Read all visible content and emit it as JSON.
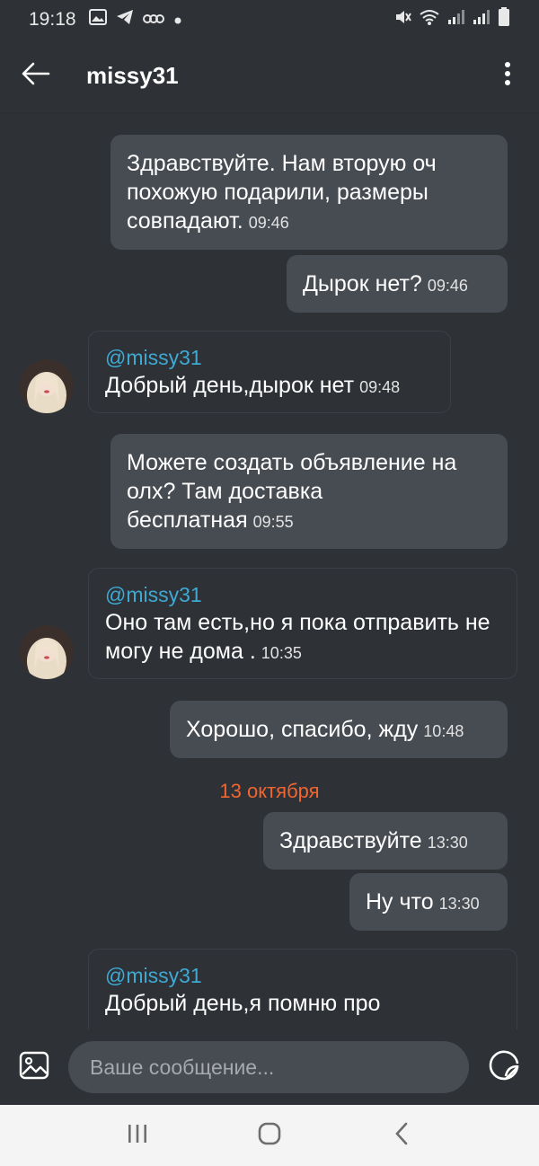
{
  "status_bar": {
    "time": "19:18",
    "icons_left": [
      "gallery-icon",
      "telegram-icon",
      "vpn-icon",
      "dot-icon"
    ],
    "icons_right": [
      "mute-icon",
      "wifi-icon",
      "signal-icon",
      "signal-icon",
      "battery-icon"
    ]
  },
  "header": {
    "title": "missy31",
    "back_icon": "arrow-left-icon",
    "menu_icon": "more-vert-icon"
  },
  "messages": [
    {
      "direction": "out",
      "text": "Здравствуйте. Нам вторую оч похожую подарили, размеры совпадают.",
      "time": "09:46"
    },
    {
      "direction": "out",
      "text": "Дырок нет?",
      "time": "09:46"
    },
    {
      "direction": "in",
      "author": "@missy31",
      "text": "Добрый день,дырок нет",
      "time": "09:48"
    },
    {
      "direction": "out",
      "text": "Можете создать объявление на олх? Там доставка бесплатная",
      "time": "09:55"
    },
    {
      "direction": "in",
      "author": "@missy31",
      "text": "Оно там есть,но я пока отправить не могу не дома .",
      "time": "10:35"
    },
    {
      "direction": "out",
      "text": "Хорошо, спасибо, жду",
      "time": "10:48"
    },
    {
      "direction": "out",
      "text": "Здравствуйте",
      "time": "13:30"
    },
    {
      "direction": "out",
      "text": "Ну что",
      "time": "13:30"
    },
    {
      "direction": "in",
      "author": "@missy31",
      "text": "Добрый день,я помню про",
      "time": ""
    }
  ],
  "date_separator": "13 октября",
  "composer": {
    "placeholder": "Ваше сообщение...",
    "attach_icon": "image-icon",
    "sticker_icon": "sticker-icon"
  },
  "nav_bar": {
    "items": [
      "recent-apps-icon",
      "home-icon",
      "back-icon"
    ]
  },
  "colors": {
    "background": "#2e3136",
    "outgoing_bubble": "#474b52",
    "author": "#3fa9d4",
    "date_separator": "#f06530",
    "nav_bar": "#f4f4f4"
  }
}
